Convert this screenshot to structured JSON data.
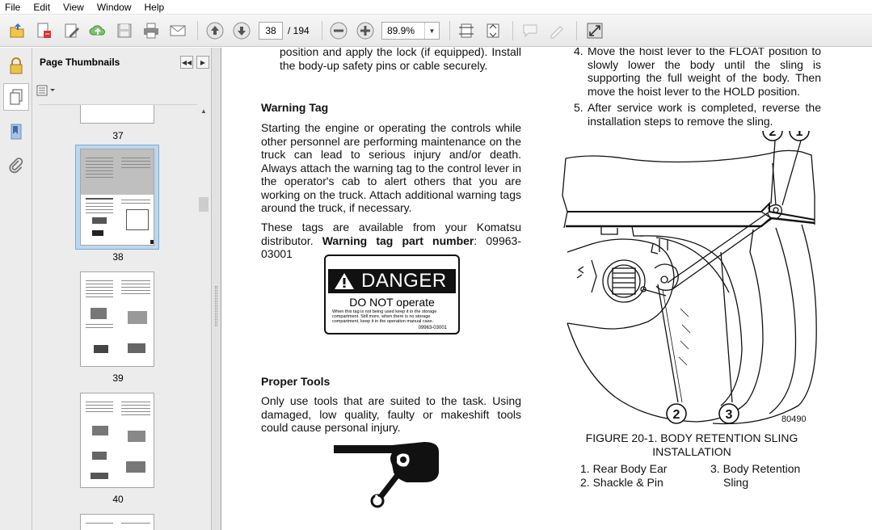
{
  "menu": [
    "File",
    "Edit",
    "View",
    "Window",
    "Help"
  ],
  "toolbar": {
    "page_current": "38",
    "page_total": "/ 194",
    "zoom": "89.9%"
  },
  "icons": [
    "open-icon",
    "create-pdf-icon",
    "edit-icon",
    "upload-icon",
    "save-icon",
    "print-icon",
    "email-icon",
    "page-up-icon",
    "page-down-icon",
    "zoom-out-icon",
    "zoom-in-icon",
    "fit-page-icon",
    "fit-width-icon",
    "comment-icon",
    "sign-icon",
    "full-screen-icon"
  ],
  "panel": {
    "title": "Page Thumbnails",
    "thumbs": [
      {
        "label": "37"
      },
      {
        "label": "38"
      },
      {
        "label": "39"
      },
      {
        "label": "40"
      }
    ]
  },
  "doc": {
    "top_left": "position and apply the lock (if equipped). Install the body-up safety pins or cable securely.",
    "warning_heading": "Warning Tag",
    "warning_p1": "Starting the engine or operating the controls while other personnel are performing maintenance on the truck can lead to serious injury and/or death. Always attach the warning tag to the control lever in the operator's cab to alert others that you are working on the truck. Attach additional warning tags around the truck, if necessary.",
    "warning_p2_a": "These tags are available from your Komatsu distributor. ",
    "warning_p2_b": "Warning tag part number",
    "warning_p2_c": ": 09963-03001",
    "danger": {
      "title": "DANGER",
      "sub": "DO NOT operate",
      "small1": "When this tag is not being used keep it in the storage",
      "small2": "compartment. Still more, when there is no storage",
      "small3": "compartment, keep it in the operation manual case.",
      "part": "09963-03001"
    },
    "tools_heading": "Proper Tools",
    "tools_p": "Only use tools that are suited to the task. Using damaged, low quality, faulty or makeshift tools could cause personal injury.",
    "steps": [
      {
        "num": "4.",
        "text": "Move the hoist lever to the FLOAT position to slowly lower the body until the sling is supporting the full weight of the body. Then move the hoist lever to the HOLD position."
      },
      {
        "num": "5.",
        "text": "After service work is completed, reverse the installation steps to remove the sling."
      }
    ],
    "figure": {
      "callouts": [
        "2",
        "1",
        "2",
        "3"
      ],
      "ref": "80490",
      "caption1": "FIGURE 20-1. BODY RETENTION SLING",
      "caption2": "INSTALLATION",
      "legend_l1": "1. Rear Body Ear",
      "legend_l2": "2. Shackle & Pin",
      "legend_r1": "3. Body Retention",
      "legend_r2": "Sling"
    }
  }
}
